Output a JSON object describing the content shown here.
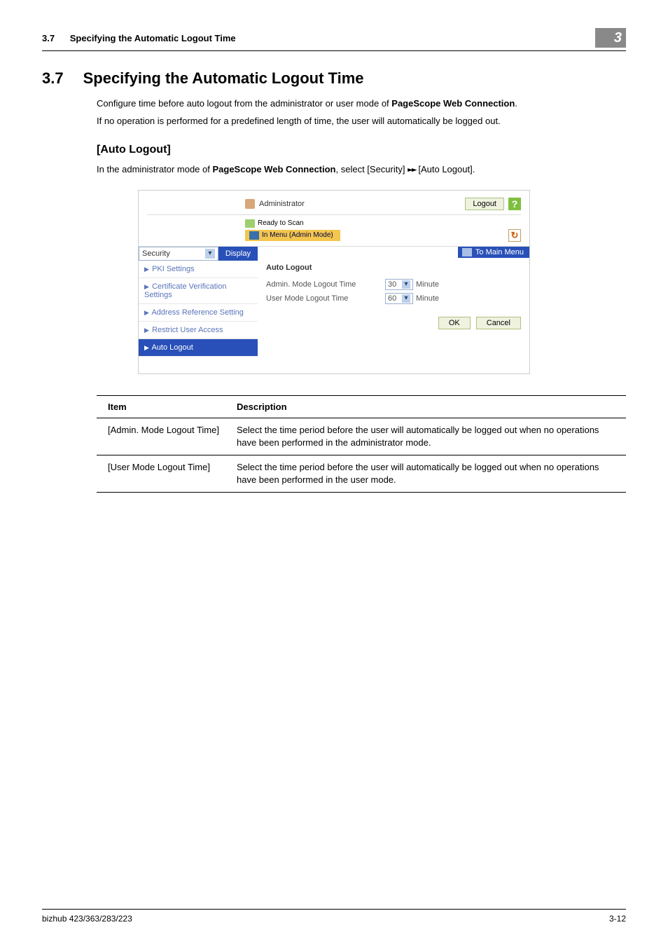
{
  "header": {
    "section_ref": "3.7",
    "section_short_title": "Specifying the Automatic Logout Time",
    "chapter_badge": "3"
  },
  "section": {
    "number": "3.7",
    "title": "Specifying the Automatic Logout Time",
    "para1_a": "Configure time before auto logout from the administrator or user mode of ",
    "para1_b": "PageScope Web Connection",
    "para1_c": ".",
    "para2": "If no operation is performed for a predefined length of time, the user will automatically be logged out."
  },
  "subheading": "[Auto Logout]",
  "subpara_a": "In the administrator mode of ",
  "subpara_b": "PageScope Web Connection",
  "subpara_c": ", select [Security] ",
  "subpara_d": " [Auto Logout].",
  "screenshot": {
    "administrator": "Administrator",
    "logout": "Logout",
    "help": "?",
    "ready": "Ready to Scan",
    "menu_badge": "In Menu (Admin Mode)",
    "refresh": "↻",
    "category_select": "Security",
    "display_btn": "Display",
    "main_menu_btn": "To Main Menu",
    "nav": {
      "pki": "PKI Settings",
      "cert": "Certificate Verification Settings",
      "addr": "Address Reference Setting",
      "restrict": "Restrict User Access",
      "auto": "Auto Logout"
    },
    "panel": {
      "title": "Auto Logout",
      "admin_label": "Admin. Mode Logout Time",
      "admin_value": "30",
      "user_label": "User Mode Logout Time",
      "user_value": "60",
      "unit": "Minute",
      "ok": "OK",
      "cancel": "Cancel"
    }
  },
  "table": {
    "h1": "Item",
    "h2": "Description",
    "r1c1": "[Admin. Mode Logout Time]",
    "r1c2": "Select the time period before the user will automatically be logged out when no operations have been performed in the administrator mode.",
    "r2c1": "[User Mode Logout Time]",
    "r2c2": "Select the time period before the user will automatically be logged out when no operations have been performed in the user mode."
  },
  "footer": {
    "left": "bizhub 423/363/283/223",
    "right": "3-12"
  }
}
